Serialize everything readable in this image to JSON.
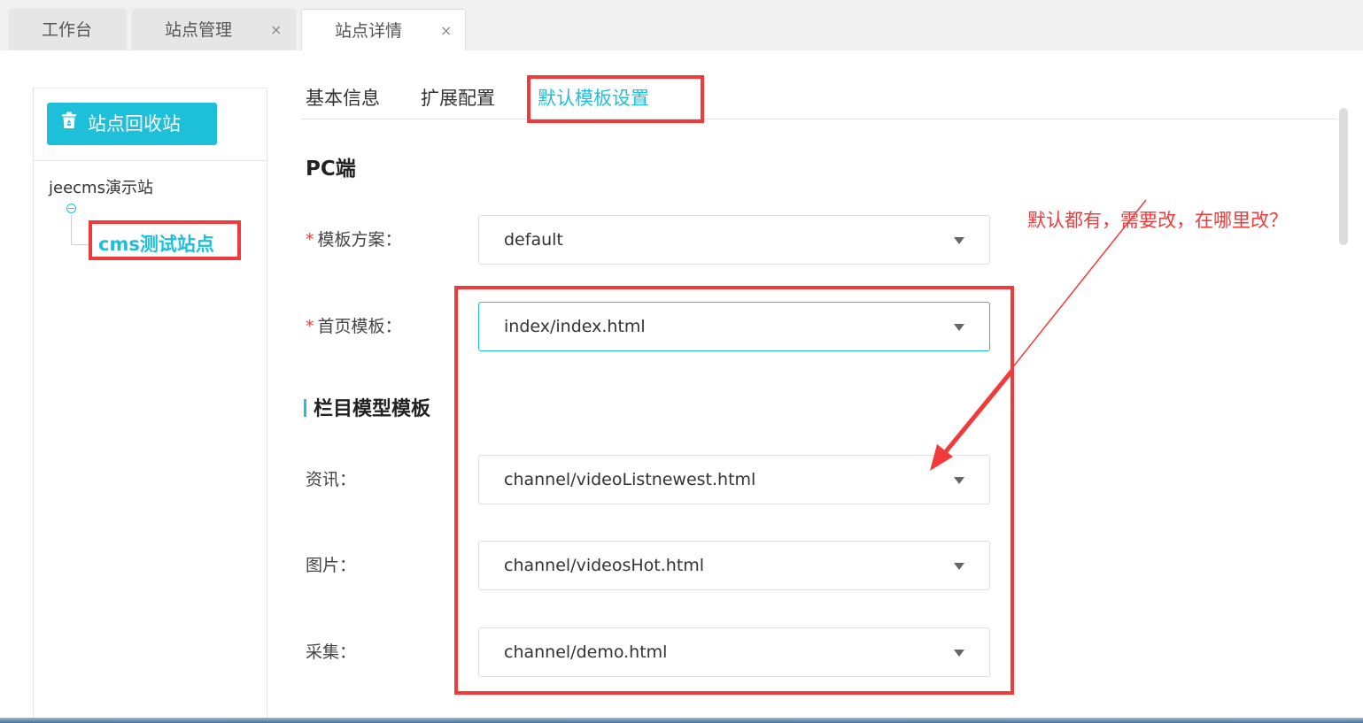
{
  "tabs": [
    {
      "label": "工作台",
      "closable": false,
      "active": false
    },
    {
      "label": "站点管理",
      "closable": true,
      "active": false
    },
    {
      "label": "站点详情",
      "closable": true,
      "active": true
    }
  ],
  "close_glyph": "×",
  "sidebar": {
    "recycle_button": "站点回收站",
    "recycle_icon": "recycle-bin-icon",
    "tree": {
      "root": "jeecms演示站",
      "toggle_glyph": "⊖",
      "child": "cms测试站点"
    }
  },
  "content_tabs": [
    {
      "label": "基本信息",
      "active": false
    },
    {
      "label": "扩展配置",
      "active": false
    },
    {
      "label": "默认模板设置",
      "active": true
    }
  ],
  "form": {
    "section_title": "PC端",
    "template_scheme": {
      "label": "模板方案：",
      "required": true,
      "value": "default"
    },
    "home_template": {
      "label": "首页模板：",
      "required": true,
      "value": "index/index.html"
    },
    "channel_model_title": "栏目模型模板",
    "channels": [
      {
        "label": "资讯：",
        "value": "channel/videoListnewest.html"
      },
      {
        "label": "图片：",
        "value": "channel/videosHot.html"
      },
      {
        "label": "采集：",
        "value": "channel/demo.html"
      }
    ],
    "required_mark": "*"
  },
  "annotation": "默认都有，需要改，在哪里改？",
  "colors": {
    "accent": "#1ec0d9",
    "highlight": "#f23a3a"
  }
}
